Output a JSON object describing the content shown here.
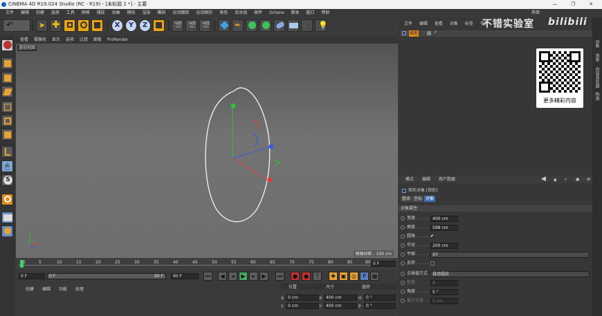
{
  "window": {
    "title": "CINEMA 4D R19.024 Studio (RC - R19) - [未标题 2 *] - 主要",
    "controls": [
      "—",
      "❐",
      "✕"
    ]
  },
  "menubar": [
    "文件",
    "编辑",
    "创建",
    "选择",
    "工具",
    "网格",
    "捕捉",
    "动画",
    "模拟",
    "渲染",
    "雕刻",
    "运动跟踪",
    "运动图形",
    "角色",
    "流水线",
    "插件",
    "Octane",
    "脚本",
    "窗口",
    "帮助"
  ],
  "layout_label": "界面",
  "toolbar": {
    "axis_buttons": [
      "X",
      "Y",
      "Z"
    ]
  },
  "viewport": {
    "menu": [
      "查看",
      "摄像机",
      "显示",
      "选项",
      "过滤",
      "面板",
      "ProRender"
    ],
    "label": "透视视图",
    "grid_info": "网格间距 : 100 cm"
  },
  "timeline": {
    "ticks": [
      "0",
      "5",
      "10",
      "15",
      "20",
      "25",
      "30",
      "35",
      "40",
      "45",
      "50",
      "55",
      "60",
      "65",
      "70",
      "75",
      "80",
      "85",
      "90"
    ],
    "end_frame": "0 F"
  },
  "transport": {
    "start": "0 F",
    "current": "0 F",
    "end": "90 F",
    "end2": "90 F"
  },
  "material_menu": [
    "创建",
    "编辑",
    "功能",
    "纹理"
  ],
  "coord_headers": [
    "位置",
    "尺寸",
    "旋转"
  ],
  "coords": [
    {
      "axis": "X",
      "pos": "0 cm",
      "size_axis": "X",
      "size": "400 cm",
      "rot_axis": "H",
      "rot": "0 °"
    },
    {
      "axis": "Y",
      "pos": "0 cm",
      "size_axis": "Y",
      "size": "400 cm",
      "rot_axis": "P",
      "rot": "0 °"
    }
  ],
  "object_manager": {
    "menu": [
      "文件",
      "编辑",
      "查看",
      "对象",
      "标签",
      "书签"
    ],
    "object_name": "矩形"
  },
  "watermark": {
    "text": "不错实验室",
    "site": "bilibili",
    "qr_caption": "更多精彩内容"
  },
  "attributes": {
    "menu": [
      "模式",
      "编辑",
      "用户数据"
    ],
    "title": "矩形对象 [矩形]",
    "tabs": [
      "基本",
      "坐标",
      "对象"
    ],
    "active_tab": "对象",
    "section": "对象属性",
    "props": [
      {
        "label": "宽度 . . . . .",
        "value": "400 cm"
      },
      {
        "label": "高度 . . . . .",
        "value": "598 cm"
      },
      {
        "label": "圆角 . . . . .",
        "value": "✔"
      },
      {
        "label": "半径 . . . . .",
        "value": "200 cm"
      },
      {
        "label": "平面 . . . . .",
        "value": "XY"
      },
      {
        "label": "反转 . . . . .",
        "value": ""
      },
      {
        "label": "点插值方式",
        "value": "自动适应"
      },
      {
        "label": "数量 . . . . .",
        "value": "8"
      },
      {
        "label": "角度 . . . . .",
        "value": "5 °"
      },
      {
        "label": "最大长度 . .",
        "value": "5 cm"
      }
    ]
  },
  "side_tabs": [
    "对象",
    "场景",
    "内容浏览器",
    "构造"
  ],
  "colors": {
    "accent": "#3d6cb3",
    "spline": "#e8e8e8",
    "axis_x": "#e03a3a",
    "axis_y": "#2fc42f",
    "axis_z": "#3a5ae0"
  }
}
